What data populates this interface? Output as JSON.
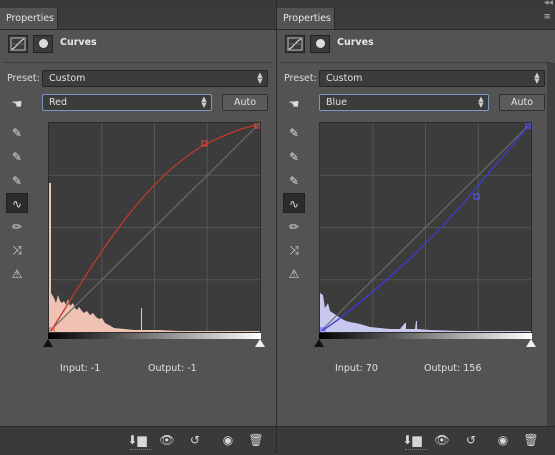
{
  "panels": [
    {
      "tab_label": "Properties",
      "header_title": "Curves",
      "preset_label": "Preset:",
      "preset_value": "Custom",
      "channel_value": "Red",
      "auto_label": "Auto",
      "input_label": "Input:",
      "input_value": "-1",
      "output_label": "Output:",
      "output_value": "-1",
      "curve_color": "#c0392b",
      "gradient_end": "#ffffff"
    },
    {
      "tab_label": "Properties",
      "header_title": "Curves",
      "preset_label": "Preset:",
      "preset_value": "Custom",
      "channel_value": "Blue",
      "auto_label": "Auto",
      "input_label": "Input:",
      "input_value": "70",
      "output_label": "Output:",
      "output_value": "156",
      "curve_color": "#3b3bd6",
      "gradient_end": "#ffffff"
    }
  ],
  "icons": {
    "tools": [
      "sample-hand-icon",
      "eyedropper-black-icon",
      "eyedropper-gray-icon",
      "eyedropper-white-icon",
      "curve-points-icon",
      "pencil-icon",
      "smooth-icon",
      "clipping-warning-icon"
    ],
    "bottom": [
      "clip-to-layer-icon",
      "view-previous-icon",
      "reset-icon",
      "visibility-eye-icon",
      "trash-icon"
    ]
  }
}
